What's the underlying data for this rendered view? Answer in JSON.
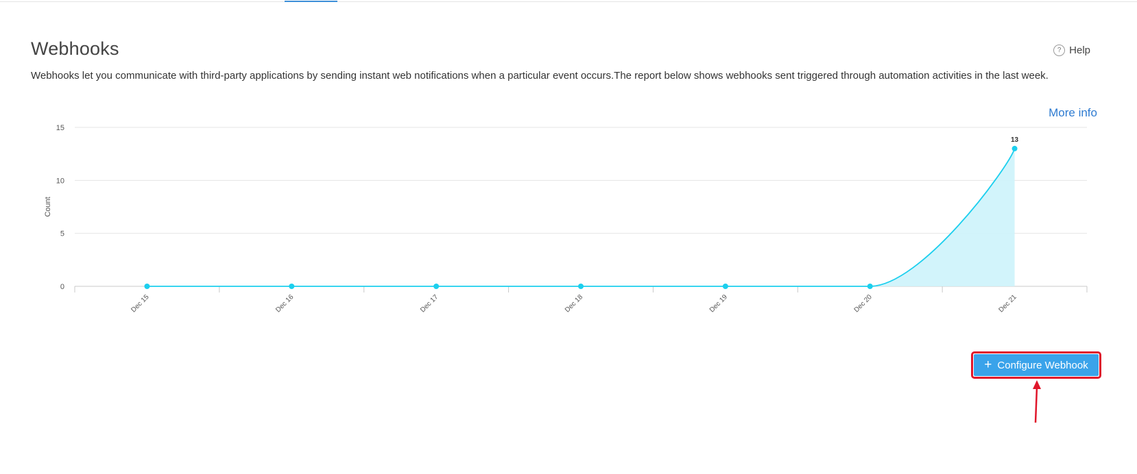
{
  "header": {
    "title": "Webhooks",
    "help_label": "Help",
    "help_icon": "question-circle-icon"
  },
  "description": "Webhooks let you communicate with third-party applications by sending instant web notifications when a particular event occurs.The report below shows webhooks sent triggered through automation activities in the last week.",
  "more_info_label": "More info",
  "configure_button": {
    "label": "Configure Webhook",
    "icon": "plus-icon"
  },
  "colors": {
    "accent": "#3aa3ea",
    "series_line": "#1ccfee",
    "series_fill": "#cdf3fb",
    "link": "#2e7bd1",
    "highlight": "#e0162b"
  },
  "chart_data": {
    "type": "area",
    "ylabel": "Count",
    "xlabel": "",
    "categories": [
      "Dec 15",
      "Dec 16",
      "Dec 17",
      "Dec 18",
      "Dec 19",
      "Dec 20",
      "Dec 21"
    ],
    "series": [
      {
        "values": [
          0,
          0,
          0,
          0,
          0,
          0,
          13
        ]
      }
    ],
    "ylim": [
      0,
      15
    ],
    "yticks": [
      0,
      5,
      10,
      15
    ],
    "data_labels": [
      "",
      "",
      "",
      "",
      "",
      "",
      "13"
    ],
    "grid": true,
    "legend": "none"
  }
}
